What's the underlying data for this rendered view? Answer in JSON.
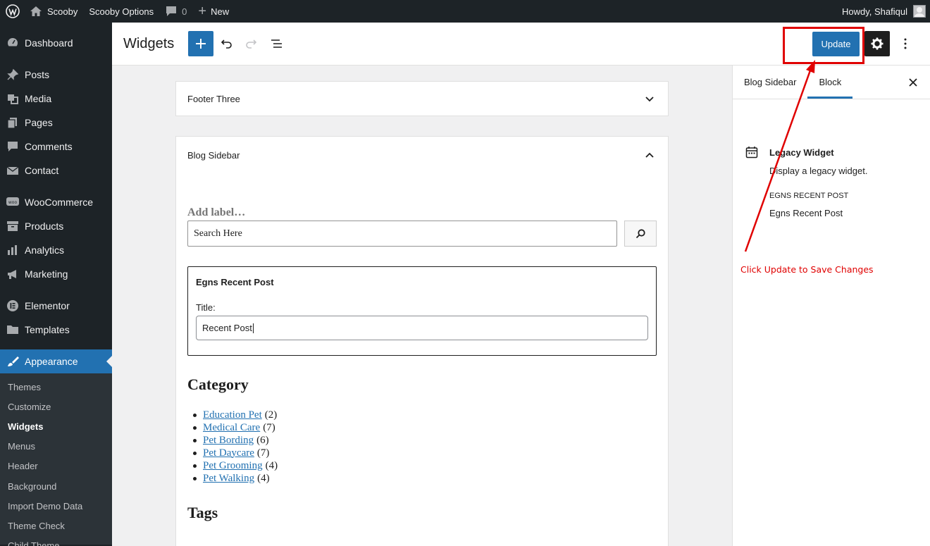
{
  "admin_bar": {
    "site_name": "Scooby",
    "options": "Scooby Options",
    "comments_count": "0",
    "new_label": "New",
    "howdy": "Howdy, Shafiqul"
  },
  "sidebar": {
    "items": [
      {
        "label": "Dashboard",
        "icon": "dashboard-icon"
      },
      {
        "label": "Posts",
        "icon": "pin-icon"
      },
      {
        "label": "Media",
        "icon": "media-icon"
      },
      {
        "label": "Pages",
        "icon": "pages-icon"
      },
      {
        "label": "Comments",
        "icon": "comment-icon"
      },
      {
        "label": "Contact",
        "icon": "mail-icon"
      },
      {
        "label": "WooCommerce",
        "icon": "woo-icon"
      },
      {
        "label": "Products",
        "icon": "archive-icon"
      },
      {
        "label": "Analytics",
        "icon": "bar-chart-icon"
      },
      {
        "label": "Marketing",
        "icon": "megaphone-icon"
      },
      {
        "label": "Elementor",
        "icon": "elementor-icon"
      },
      {
        "label": "Templates",
        "icon": "folder-icon"
      },
      {
        "label": "Appearance",
        "icon": "brush-icon"
      }
    ],
    "submenu": [
      "Themes",
      "Customize",
      "Widgets",
      "Menus",
      "Header",
      "Background",
      "Import Demo Data",
      "Theme Check",
      "Child Theme"
    ]
  },
  "header": {
    "title": "Widgets",
    "update_label": "Update"
  },
  "canvas": {
    "footer_three": "Footer Three",
    "blog_sidebar": "Blog Sidebar",
    "search_label": "Add label…",
    "search_placeholder": "Search Here",
    "legacy_title": "Egns Recent Post",
    "legacy_field_label": "Title:",
    "legacy_field_value": "Recent Post",
    "category_heading": "Category",
    "categories": [
      {
        "name": "Education Pet",
        "count": "(2)"
      },
      {
        "name": "Medical Care",
        "count": "(7)"
      },
      {
        "name": "Pet Bording",
        "count": "(6)"
      },
      {
        "name": "Pet Daycare",
        "count": "(7)"
      },
      {
        "name": "Pet Grooming",
        "count": "(4)"
      },
      {
        "name": "Pet Walking",
        "count": "(4)"
      }
    ],
    "tags_heading": "Tags"
  },
  "inspector": {
    "tab_area": "Blog Sidebar",
    "tab_block": "Block",
    "block_title": "Legacy Widget",
    "block_desc": "Display a legacy widget.",
    "widget_id": "EGNS RECENT POST",
    "widget_name": "Egns Recent Post"
  },
  "annotation": {
    "text": "Click Update to Save Changes",
    "color": "#e00000"
  },
  "colors": {
    "accent": "#2271b1",
    "admin_dark": "#1d2327"
  }
}
